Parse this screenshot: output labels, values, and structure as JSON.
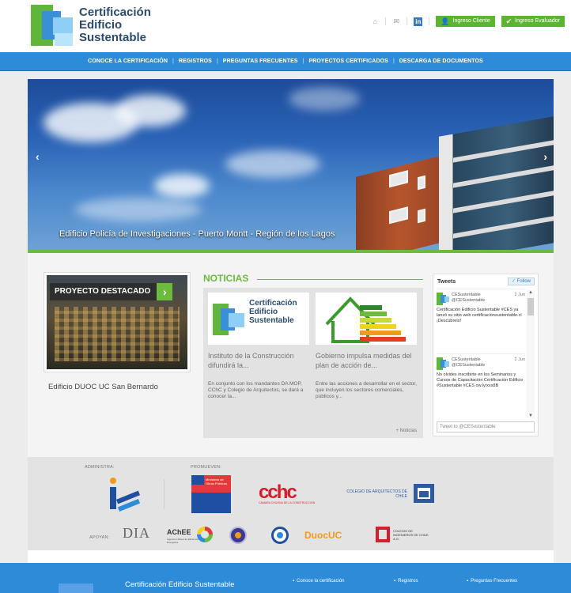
{
  "header": {
    "logo_lines": [
      "Certificación",
      "Edificio",
      "Sustentable"
    ],
    "login_client": "Ingreso Cliente",
    "login_evaluator": "Ingreso Evaluador",
    "linkedin_letter": "in"
  },
  "nav": {
    "items": [
      "CONOCE LA CERTIFICACIÓN",
      "REGISTROS",
      "PREGUNTAS FRECUENTES",
      "PROYECTOS CERTIFICADOS",
      "DESCARGA DE DOCUMENTOS"
    ],
    "separator": "|"
  },
  "hero": {
    "caption": "Edificio Policía de Investigaciones - Puerto Montt - Región de los Lagos",
    "prev_glyph": "‹",
    "next_glyph": "›"
  },
  "featured": {
    "label": "PROYECTO DESTACADO",
    "caption": "Edificio DUOC UC San Bernardo"
  },
  "news": {
    "title": "NOTICIAS",
    "items": [
      {
        "logo_lines": [
          "Certificación",
          "Edificio",
          "Sustentable"
        ],
        "headline": "Instituto de la Construcción difundirá la...",
        "excerpt": "En conjunto con los mandantes DA MOP, CChC y Colegio de Arquitectos, se dará a conocer la..."
      },
      {
        "headline": "Gobierno impulsa medidas del plan de acción de...",
        "excerpt": "Entre las acciones a desarrollar en el sector, que incluyen los sectores comerciales, públicos y..."
      }
    ],
    "more": "+ Noticias"
  },
  "tweets": {
    "title": "Tweets",
    "follow": "Follow",
    "items": [
      {
        "name": "CESustentable",
        "handle": "@CESustentable",
        "date": "2 Jun",
        "text": "Certificación Edificio Sustentable #CES ya lanzó su sitio web certificacionsustentable.cl ¡Descúbrelo!",
        "tag": "#CES"
      },
      {
        "name": "CESustentable",
        "handle": "@CESustentable",
        "date": "2 Jun",
        "text": "No olvides inscribirte en los Seminarios y Cursos de Capacitación Certificación Edificio #Sustentable #CES ow.ly/xxx8B",
        "tag": "#Sustentable #CES"
      }
    ],
    "input_placeholder": "Tweet to @CESustentable"
  },
  "partners": {
    "administra_label": "ADMINISTRA:",
    "promueven_label": "PROMUEVEN:",
    "apoyan_label": "APOYAN:",
    "cchc": "cchc",
    "cchc_sub": "CAMARA CHILENA DE LA CONSTRUCCION",
    "colegio_arq": "COLEGIO DE ARQUITECTOS DE CHILE",
    "dia": "DIA",
    "achee": "AChEE",
    "achee_sub": "Agencia Chilena de Eficiencia Energética",
    "duoc": "DuocUC",
    "colegio_ing": "COLEGIO DE INGENIEROS DE CHILE A.G.",
    "gob_line": "Ministerio de Obras Públicas"
  },
  "footer": {
    "title": "Certificación Edificio Sustentable",
    "links": [
      "Conoce la certificación",
      "Registros",
      "Preguntas Frecuentes"
    ]
  },
  "colors": {
    "brand_blue": "#2e8bd8",
    "brand_green": "#6cbb3c",
    "logo_text": "#2a4a6e"
  }
}
